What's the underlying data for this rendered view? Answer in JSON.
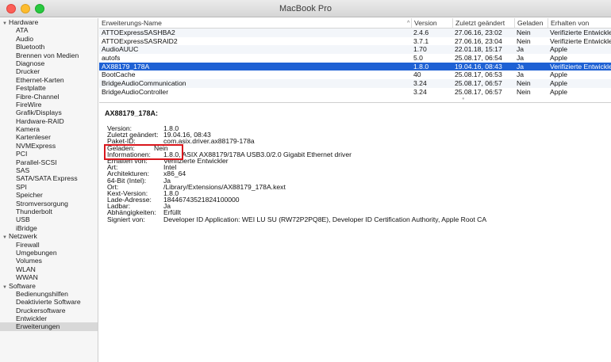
{
  "window": {
    "title": "MacBook Pro"
  },
  "sidebar": {
    "groups": [
      {
        "label": "Hardware",
        "items": [
          "ATA",
          "Audio",
          "Bluetooth",
          "Brennen von Medien",
          "Diagnose",
          "Drucker",
          "Ethernet-Karten",
          "Festplatte",
          "Fibre-Channel",
          "FireWire",
          "Grafik/Displays",
          "Hardware-RAID",
          "Kamera",
          "Kartenleser",
          "NVMExpress",
          "PCI",
          "Parallel-SCSI",
          "SAS",
          "SATA/SATA Express",
          "SPI",
          "Speicher",
          "Stromversorgung",
          "Thunderbolt",
          "USB",
          "iBridge"
        ]
      },
      {
        "label": "Netzwerk",
        "items": [
          "Firewall",
          "Umgebungen",
          "Volumes",
          "WLAN",
          "WWAN"
        ]
      },
      {
        "label": "Software",
        "items": [
          "Bedienungshilfen",
          "Deaktivierte Software",
          "Druckersoftware",
          "Entwickler",
          "Erweiterungen"
        ]
      }
    ],
    "selected": "Erweiterungen"
  },
  "list": {
    "columns": [
      "Erweiterungs-Name",
      "Version",
      "Zuletzt geändert",
      "Geladen",
      "Erhalten von"
    ],
    "sort_indicator": "^",
    "rows": [
      [
        "ATTOExpressSASHBA2",
        "2.4.6",
        "27.06.16, 23:02",
        "Nein",
        "Verifizierte Entwickler"
      ],
      [
        "ATTOExpressSASRAID2",
        "3.7.1",
        "27.06.16, 23:04",
        "Nein",
        "Verifizierte Entwickler"
      ],
      [
        "AudioAUUC",
        "1.70",
        "22.01.18, 15:17",
        "Ja",
        "Apple"
      ],
      [
        "autofs",
        "5.0",
        "25.08.17, 06:54",
        "Ja",
        "Apple"
      ],
      [
        "AX88179_178A",
        "1.8.0",
        "19.04.16, 08:43",
        "Ja",
        "Verifizierte Entwickler"
      ],
      [
        "BootCache",
        "40",
        "25.08.17, 06:53",
        "Ja",
        "Apple"
      ],
      [
        "BridgeAudioCommunication",
        "3.24",
        "25.08.17, 06:57",
        "Nein",
        "Apple"
      ],
      [
        "BridgeAudioController",
        "3.24",
        "25.08.17, 06:57",
        "Nein",
        "Apple"
      ]
    ],
    "selected_row": 4
  },
  "detail": {
    "title": "AX88179_178A:",
    "rows": [
      {
        "label": "Version:",
        "value": "1.8.0"
      },
      {
        "label": "Zuletzt geändert:",
        "value": "19.04.16, 08:43"
      },
      {
        "label": "Paket-ID:",
        "value": "com.asix.driver.ax88179-178a"
      },
      {
        "label": "Geladen:",
        "value": "Nein"
      },
      {
        "label": "Informationen:",
        "value": "1.8.0, ASIX AX88179/178A USB3.0/2.0 Gigabit Ethernet driver"
      },
      {
        "label": "Erhalten von:",
        "value": "Verifizierte Entwickler"
      },
      {
        "label": "Art:",
        "value": "Intel"
      },
      {
        "label": "Architekturen:",
        "value": "x86_64"
      },
      {
        "label": "64-Bit (Intel):",
        "value": "Ja"
      },
      {
        "label": "Ort:",
        "value": "/Library/Extensions/AX88179_178A.kext"
      },
      {
        "label": "Kext-Version:",
        "value": "1.8.0"
      },
      {
        "label": "Lade-Adresse:",
        "value": "18446743521824100000"
      },
      {
        "label": "Ladbar:",
        "value": "Ja"
      },
      {
        "label": "Abhängigkeiten:",
        "value": "Erfüllt"
      },
      {
        "label": "Signiert von:",
        "value": "Developer ID Application: WEI LU SU (RW72P2PQ8E), Developer ID Certification Authority, Apple Root CA"
      }
    ]
  }
}
